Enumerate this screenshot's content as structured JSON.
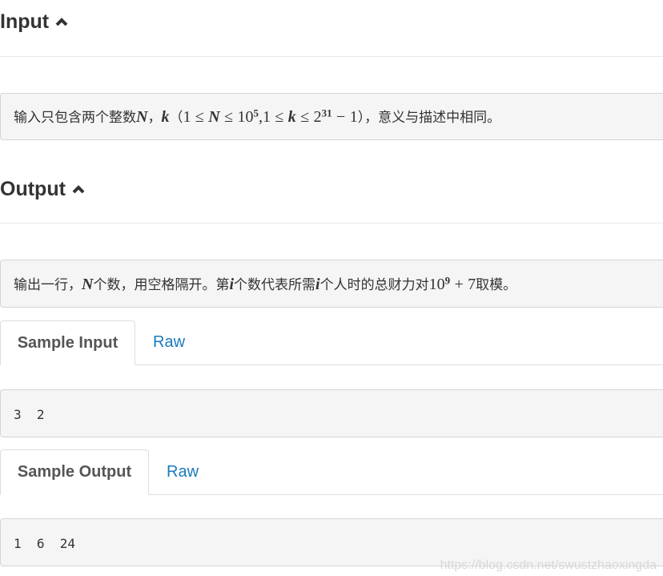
{
  "input_section": {
    "title": "Input",
    "description": {
      "prefix": "输入只包含两个整数",
      "sep1": "，",
      "open_paren": "（",
      "close_paren": "），意义与描述中相同。",
      "var_n": "N",
      "var_k": "k",
      "one": "1",
      "le": "≤",
      "ten": "10",
      "exp5": "5",
      "two": "2",
      "exp31": "31",
      "minus": "−",
      "comma": ","
    }
  },
  "output_section": {
    "title": "Output",
    "description": {
      "part1": "输出一行，",
      "var_n": "N",
      "part2": "个数，用空格隔开。第",
      "var_i1": "i",
      "part3": "个数代表所需",
      "var_i2": "i",
      "part4": "个人时的总财力对",
      "ten": "10",
      "exp9": "9",
      "plus": "+",
      "seven": "7",
      "part5": "取模。"
    }
  },
  "sample_input": {
    "tab_label": "Sample Input",
    "raw_label": "Raw",
    "content": "3 2"
  },
  "sample_output": {
    "tab_label": "Sample Output",
    "raw_label": "Raw",
    "content": "1 6 24"
  },
  "watermark": "https://blog.csdn.net/swustzhaoxingda",
  "colors": {
    "link": "#1a7bbf",
    "panel_bg": "#f5f5f5",
    "text": "#333333"
  }
}
